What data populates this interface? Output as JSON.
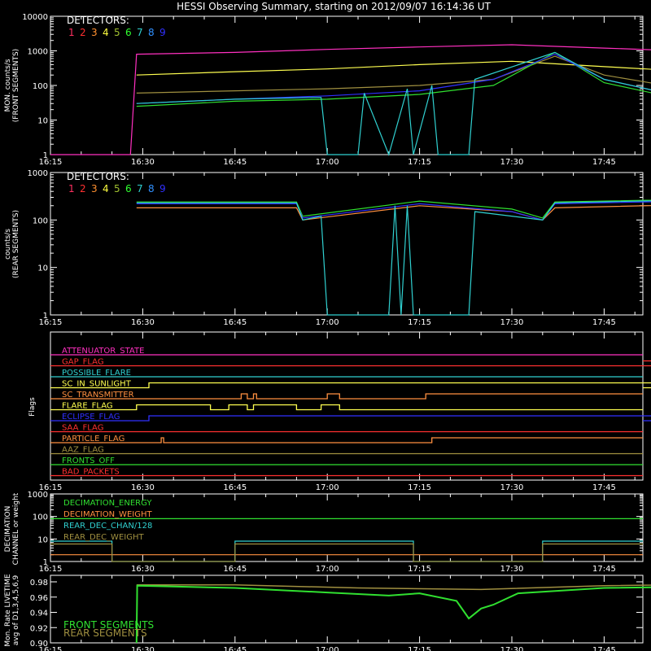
{
  "title": "HESSI Observing Summary, starting on 2012/09/07 16:14:36 UT",
  "x_tick_labels": [
    "16:15",
    "16:30",
    "16:45",
    "17:00",
    "17:15",
    "17:30",
    "17:45"
  ],
  "detectors": {
    "label": "DETECTORS:",
    "numbers": [
      "1",
      "2",
      "3",
      "4",
      "5",
      "6",
      "7",
      "8",
      "9"
    ],
    "colors": [
      "#ff3060",
      "#ff3030",
      "#ff9030",
      "#ffff40",
      "#a0c030",
      "#30ff30",
      "#30d0d0",
      "#3090ff",
      "#3030ff"
    ]
  },
  "colors": {
    "background": "#000000",
    "axis": "#ffffff",
    "magenta": "#ff30c0",
    "yellow": "#ffff50",
    "olive": "#a09040",
    "cyan": "#30d0d0",
    "green": "#30e030",
    "orange": "#ff9040",
    "red": "#ff3030",
    "blue": "#3030ff"
  },
  "chart_data": [
    {
      "type": "line",
      "panel": "front",
      "ylabel": [
        "MON. counts/s",
        "(FRONT SEGMENTS)"
      ],
      "yscale": "log",
      "ylim": [
        1,
        10000
      ],
      "y_tick_labels": [
        "1",
        "10",
        "100",
        "1000",
        "10000"
      ],
      "xlim_min": [
        0,
        114
      ],
      "series": [
        {
          "color_key": "magenta",
          "points": [
            [
              0,
              1
            ],
            [
              13,
              1
            ],
            [
              14,
              800
            ],
            [
              30,
              900
            ],
            [
              45,
              1100
            ],
            [
              60,
              1300
            ],
            [
              75,
              1500
            ],
            [
              90,
              1200
            ],
            [
              110,
              900
            ],
            [
              120,
              900
            ],
            [
              121,
              1
            ]
          ]
        },
        {
          "color_key": "yellow",
          "points": [
            [
              14,
              200
            ],
            [
              30,
              250
            ],
            [
              45,
              300
            ],
            [
              60,
              400
            ],
            [
              75,
              500
            ],
            [
              90,
              350
            ],
            [
              105,
              250
            ],
            [
              120,
              250
            ],
            [
              121,
              1
            ]
          ]
        },
        {
          "color_key": "olive",
          "points": [
            [
              14,
              60
            ],
            [
              30,
              70
            ],
            [
              45,
              80
            ],
            [
              60,
              100
            ],
            [
              72,
              150
            ],
            [
              82,
              700
            ],
            [
              90,
              200
            ],
            [
              100,
              100
            ],
            [
              120,
              80
            ]
          ]
        },
        {
          "color_key": "green",
          "points": [
            [
              14,
              25
            ],
            [
              30,
              35
            ],
            [
              45,
              40
            ],
            [
              60,
              55
            ],
            [
              72,
              100
            ],
            [
              82,
              900
            ],
            [
              90,
              120
            ],
            [
              100,
              50
            ],
            [
              120,
              40
            ]
          ]
        },
        {
          "color_key": "blue",
          "points": [
            [
              14,
              30
            ],
            [
              30,
              40
            ],
            [
              45,
              50
            ],
            [
              60,
              70
            ],
            [
              72,
              150
            ],
            [
              82,
              800
            ],
            [
              90,
              150
            ],
            [
              100,
              60
            ],
            [
              120,
              50
            ]
          ]
        },
        {
          "color_key": "cyan",
          "points": [
            [
              14,
              30
            ],
            [
              30,
              40
            ],
            [
              44,
              45
            ],
            [
              45,
              1
            ],
            [
              50,
              1
            ],
            [
              51,
              60
            ],
            [
              55,
              1
            ],
            [
              58,
              80
            ],
            [
              59,
              1
            ],
            [
              62,
              100
            ],
            [
              63,
              1
            ],
            [
              68,
              1
            ],
            [
              69,
              150
            ],
            [
              82,
              900
            ],
            [
              90,
              150
            ],
            [
              100,
              60
            ],
            [
              120,
              50
            ]
          ]
        }
      ]
    },
    {
      "type": "line",
      "panel": "rear",
      "ylabel": [
        "counts/s",
        "(REAR SEGMENTS)"
      ],
      "yscale": "log",
      "ylim": [
        1,
        1000
      ],
      "y_tick_labels": [
        "1",
        "10",
        "100",
        "1000"
      ],
      "series": [
        {
          "color_key": "orange",
          "points": [
            [
              14,
              180
            ],
            [
              40,
              180
            ],
            [
              41,
              100
            ],
            [
              60,
              200
            ],
            [
              75,
              150
            ],
            [
              80,
              100
            ],
            [
              82,
              180
            ],
            [
              110,
              220
            ],
            [
              120,
              250
            ],
            [
              121,
              1
            ]
          ]
        },
        {
          "color_key": "green",
          "points": [
            [
              14,
              240
            ],
            [
              40,
              240
            ],
            [
              41,
              120
            ],
            [
              60,
              250
            ],
            [
              75,
              170
            ],
            [
              80,
              110
            ],
            [
              82,
              240
            ],
            [
              110,
              280
            ],
            [
              120,
              300
            ],
            [
              121,
              1
            ]
          ]
        },
        {
          "color_key": "blue",
          "points": [
            [
              14,
              220
            ],
            [
              40,
              220
            ],
            [
              41,
              110
            ],
            [
              60,
              220
            ],
            [
              75,
              150
            ],
            [
              80,
              100
            ],
            [
              82,
              220
            ],
            [
              110,
              260
            ],
            [
              120,
              280
            ],
            [
              121,
              1
            ]
          ]
        },
        {
          "color_key": "cyan",
          "points": [
            [
              14,
              230
            ],
            [
              40,
              230
            ],
            [
              41,
              100
            ],
            [
              44,
              120
            ],
            [
              45,
              1
            ],
            [
              55,
              1
            ],
            [
              56,
              200
            ],
            [
              57,
              1
            ],
            [
              58,
              200
            ],
            [
              59,
              1
            ],
            [
              68,
              1
            ],
            [
              69,
              150
            ],
            [
              80,
              100
            ],
            [
              82,
              230
            ],
            [
              120,
              290
            ],
            [
              121,
              1
            ]
          ]
        }
      ]
    },
    {
      "type": "flags",
      "panel": "flags",
      "ylabel": "Flags",
      "flags": [
        {
          "label": "ATTENUATOR_STATE",
          "color_key": "magenta"
        },
        {
          "label": "GAP_FLAG",
          "color_key": "red"
        },
        {
          "label": "POSSIBLE_FLARE",
          "color_key": "cyan"
        },
        {
          "label": "SC_IN_SUNLIGHT",
          "color_key": "yellow"
        },
        {
          "label": "SC_TRANSMITTER",
          "color_key": "orange"
        },
        {
          "label": "FLARE_FLAG",
          "color_key": "yellow"
        },
        {
          "label": "ECLIPSE_FLAG",
          "color_key": "blue"
        },
        {
          "label": "SAA_FLAG",
          "color_key": "red"
        },
        {
          "label": "PARTICLE_FLAG",
          "color_key": "orange"
        },
        {
          "label": "AAZ_FLAG",
          "color_key": "olive"
        },
        {
          "label": "FRONTS_OFF",
          "color_key": "green"
        },
        {
          "label": "BAD_PACKETS",
          "color_key": "red"
        }
      ]
    },
    {
      "type": "line",
      "panel": "decimation",
      "ylabel": [
        "DECIMATION",
        "CHANNEL or weight"
      ],
      "yscale": "log",
      "ylim": [
        1,
        1000
      ],
      "y_tick_labels": [
        "1",
        "10",
        "100",
        "1000"
      ],
      "legend": [
        {
          "label": "DECIMATION_ENERGY",
          "color_key": "green"
        },
        {
          "label": "DECIMATION_WEIGHT",
          "color_key": "orange"
        },
        {
          "label": "REAR_DEC_CHAN/128",
          "color_key": "cyan"
        },
        {
          "label": "REAR_DEC_WEIGHT",
          "color_key": "olive"
        }
      ]
    },
    {
      "type": "line",
      "panel": "livetime",
      "ylabel": [
        "Mon. Rate LIVETIME",
        "avg of D1,3,4,5,6,9"
      ],
      "ylim": [
        0.9,
        0.98
      ],
      "y_tick_labels": [
        "0.90",
        "0.92",
        "0.94",
        "0.96",
        "0.98"
      ],
      "legend": [
        {
          "label": "FRONT SEGMENTS",
          "color_key": "green"
        },
        {
          "label": "REAR SEGMENTS",
          "color_key": "olive"
        }
      ]
    }
  ]
}
